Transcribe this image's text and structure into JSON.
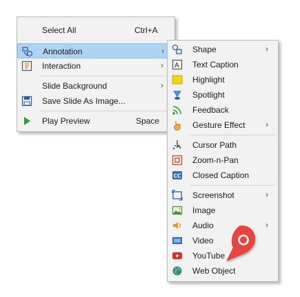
{
  "main_menu": {
    "items": [
      {
        "label": "Select All",
        "shortcut": "Ctrl+A"
      },
      {
        "label": "Annotation"
      },
      {
        "label": "Interaction"
      },
      {
        "label": "Slide Background"
      },
      {
        "label": "Save Slide As Image..."
      },
      {
        "label": "Play Preview",
        "shortcut": "Space"
      }
    ]
  },
  "sub_menu": {
    "items": [
      {
        "label": "Shape"
      },
      {
        "label": "Text Caption"
      },
      {
        "label": "Highlight"
      },
      {
        "label": "Spotlight"
      },
      {
        "label": "Feedback"
      },
      {
        "label": "Gesture Effect"
      },
      {
        "label": "Cursor Path"
      },
      {
        "label": "Zoom-n-Pan"
      },
      {
        "label": "Closed Caption"
      },
      {
        "label": "Screenshot"
      },
      {
        "label": "Image"
      },
      {
        "label": "Audio"
      },
      {
        "label": "Video"
      },
      {
        "label": "YouTube"
      },
      {
        "label": "Web Object"
      }
    ]
  },
  "submenu_arrow": "›",
  "colors": {
    "highlight_bg": "#aed3f5",
    "menu_bg": "#f2f2f2",
    "pin_red": "#e8453c",
    "play_green": "#2e9e2e"
  }
}
